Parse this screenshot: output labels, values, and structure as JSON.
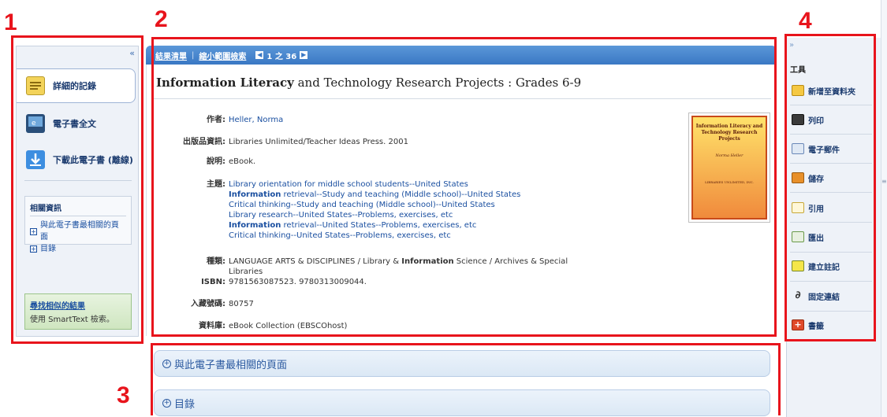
{
  "annotations": [
    "1",
    "2",
    "3",
    "4"
  ],
  "left": {
    "collapse": "«",
    "nav": [
      {
        "label": "詳細的記錄",
        "icon": "detailed-record-icon"
      },
      {
        "label": "電子書全文",
        "icon": "ebook-fulltext-icon"
      },
      {
        "label": "下載此電子書 (離線)",
        "icon": "download-icon"
      }
    ],
    "related": {
      "heading": "相關資訊",
      "items": [
        "與此電子書最相關的頁面",
        "目錄"
      ]
    },
    "find": {
      "heading": "尋找相似的結果",
      "sub": "使用 SmartText 檢索。"
    }
  },
  "topbar": {
    "back": "結果清單",
    "refine": "縮小範圍檢索",
    "page": "1 之 36"
  },
  "record": {
    "title_bold": "Information Literacy",
    "title_rest": " and Technology Research Projects : Grades 6-9",
    "author_k": "作者:",
    "author_v": "Heller, Norma",
    "pub_k": "出版品資訊:",
    "pub_v": "Libraries Unlimited/Teacher Ideas Press. 2001",
    "desc_k": "說明:",
    "desc_v": "eBook.",
    "subj_k": "主題:",
    "subjects": [
      {
        "pre": "",
        "bold": "",
        "rest": "Library orientation for middle school students--United States"
      },
      {
        "pre": "",
        "bold": "Information",
        "rest": " retrieval--Study and teaching (Middle school)--United States"
      },
      {
        "pre": "",
        "bold": "",
        "rest": "Critical thinking--Study and teaching (Middle school)--United States"
      },
      {
        "pre": "",
        "bold": "",
        "rest": "Library research--United States--Problems, exercises, etc"
      },
      {
        "pre": "",
        "bold": "Information",
        "rest": " retrieval--United States--Problems, exercises, etc"
      },
      {
        "pre": "",
        "bold": "",
        "rest": "Critical thinking--United States--Problems, exercises, etc"
      }
    ],
    "cat_k": "種類:",
    "cat_pre": "LANGUAGE ARTS & DISCIPLINES / Library & ",
    "cat_bold": "Information",
    "cat_rest": " Science / Archives & Special Libraries",
    "isbn_k": "ISBN:",
    "isbn_v": "9781563087523. 9780313009044.",
    "acc_k": "入藏號碼:",
    "acc_v": "80757",
    "db_k": "資料庫:",
    "db_v": "eBook Collection (EBSCOhost)",
    "cover": {
      "title": "Information Literacy and Technology Research Projects",
      "author": "Norma Heller",
      "publisher": "LIBRARIES UNLIMITED, INC."
    }
  },
  "accordions": [
    "與此電子書最相關的頁面",
    "目錄"
  ],
  "tools": {
    "collapse": "»",
    "title": "工具",
    "items": [
      {
        "label": "新增至資料夾",
        "icon": "folder-icon"
      },
      {
        "label": "列印",
        "icon": "print-icon"
      },
      {
        "label": "電子郵件",
        "icon": "email-icon"
      },
      {
        "label": "儲存",
        "icon": "save-icon"
      },
      {
        "label": "引用",
        "icon": "cite-icon"
      },
      {
        "label": "匯出",
        "icon": "export-icon"
      },
      {
        "label": "建立註記",
        "icon": "note-icon"
      },
      {
        "label": "固定連結",
        "icon": "permalink-icon"
      },
      {
        "label": "書籤",
        "icon": "bookmark-icon"
      }
    ]
  }
}
